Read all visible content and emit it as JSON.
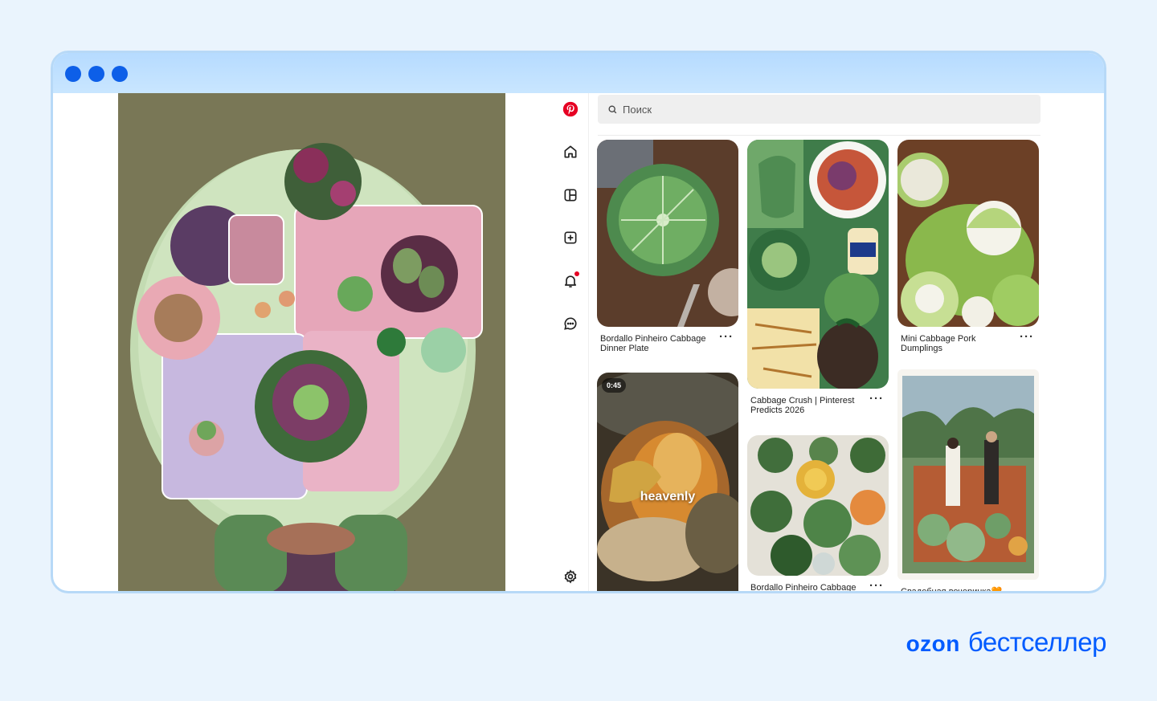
{
  "search": {
    "placeholder": "Поиск"
  },
  "sidebar": {
    "items": [
      {
        "icon": "pinterest-logo-icon"
      },
      {
        "icon": "home-icon"
      },
      {
        "icon": "boards-icon"
      },
      {
        "icon": "create-icon"
      },
      {
        "icon": "notifications-icon"
      },
      {
        "icon": "messages-icon"
      },
      {
        "icon": "settings-icon"
      }
    ]
  },
  "pins": [
    {
      "title": "Bordallo Pinheiro Cabbage Dinner Plate",
      "more": "···"
    },
    {
      "title": "Cabbage Crush | Pinterest Predicts 2026",
      "more": "···"
    },
    {
      "title": "Mini Cabbage Pork Dumplings",
      "more": "···"
    },
    {
      "title": "",
      "video_duration": "0:45",
      "overlay_text": "heavenly"
    },
    {
      "title": "Bordallo Pinheiro Cabbage",
      "more": "···"
    },
    {
      "title": "Свадебная вечеринка🧡"
    }
  ],
  "brand": {
    "logo": "ozon",
    "word": "бестселлер"
  },
  "colors": {
    "accent": "#005bff",
    "window_frame": "#b7d9f7",
    "pinterest_red": "#e60023"
  }
}
